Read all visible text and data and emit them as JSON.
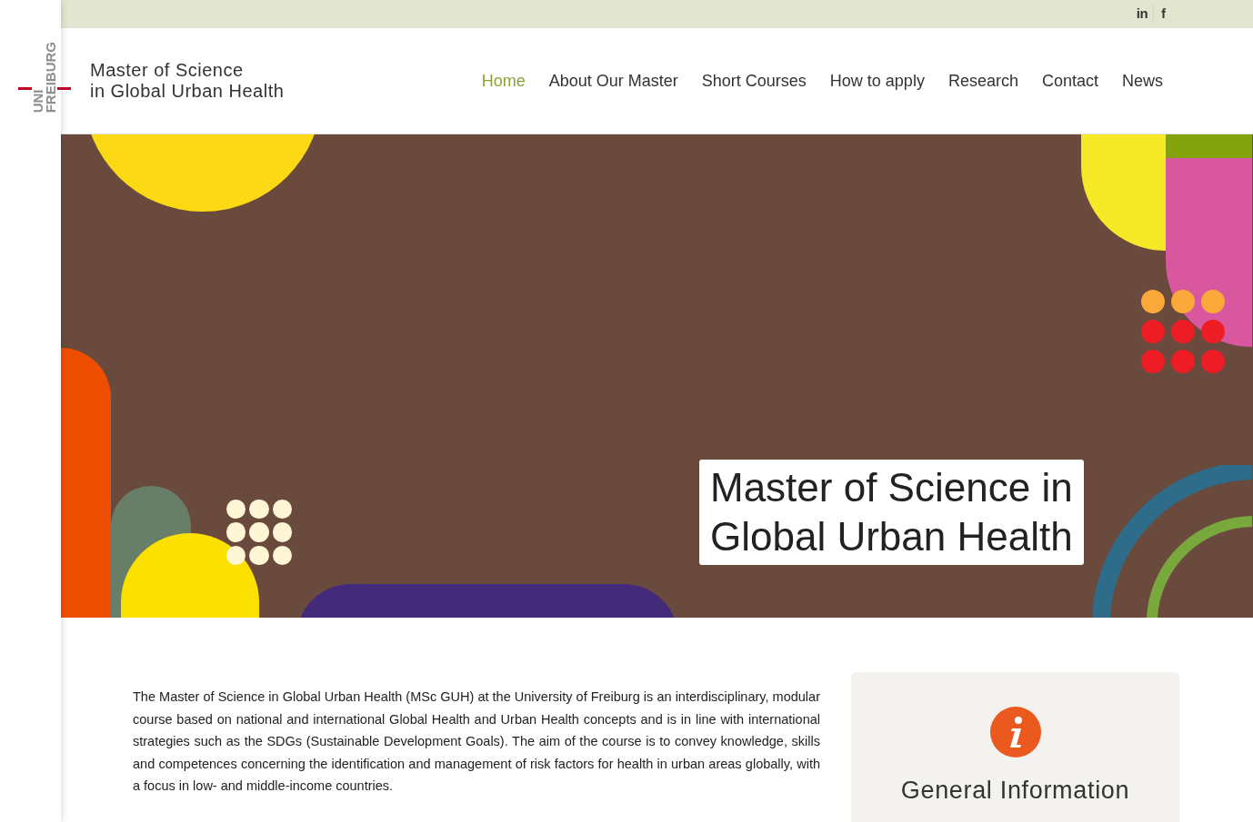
{
  "social": [
    {
      "kind": "linkedin",
      "label": "in"
    },
    {
      "kind": "facebook",
      "label": "f"
    }
  ],
  "logo": {
    "line1": "UNI",
    "line2": "FREIBURG"
  },
  "site_title": {
    "line1": "Master of Science",
    "line2": "in Global Urban Health"
  },
  "nav": [
    {
      "label": "Home",
      "selected": true
    },
    {
      "label": "About Our Master",
      "selected": false
    },
    {
      "label": "Short Courses",
      "selected": false
    },
    {
      "label": "How to apply",
      "selected": false
    },
    {
      "label": "Research",
      "selected": false
    },
    {
      "label": "Contact",
      "selected": false
    },
    {
      "label": "News",
      "selected": false
    }
  ],
  "hero": {
    "title_line1": "Master of Science in",
    "title_line2": "Global Urban Health"
  },
  "intro": "The Master of Science in Global Urban Health (MSc GUH) at the University of Freiburg is an interdisciplinary, modular course based on national and international Global Health and Urban Health concepts and is in line with international strategies such as the SDGs (Sustainable Development Goals). The aim of the course is to convey knowledge, skills and competences concerning the identification and management of risk factors for health in urban areas globally, with a focus in low- and middle-income countries.",
  "info_card": {
    "title": "General Information"
  }
}
